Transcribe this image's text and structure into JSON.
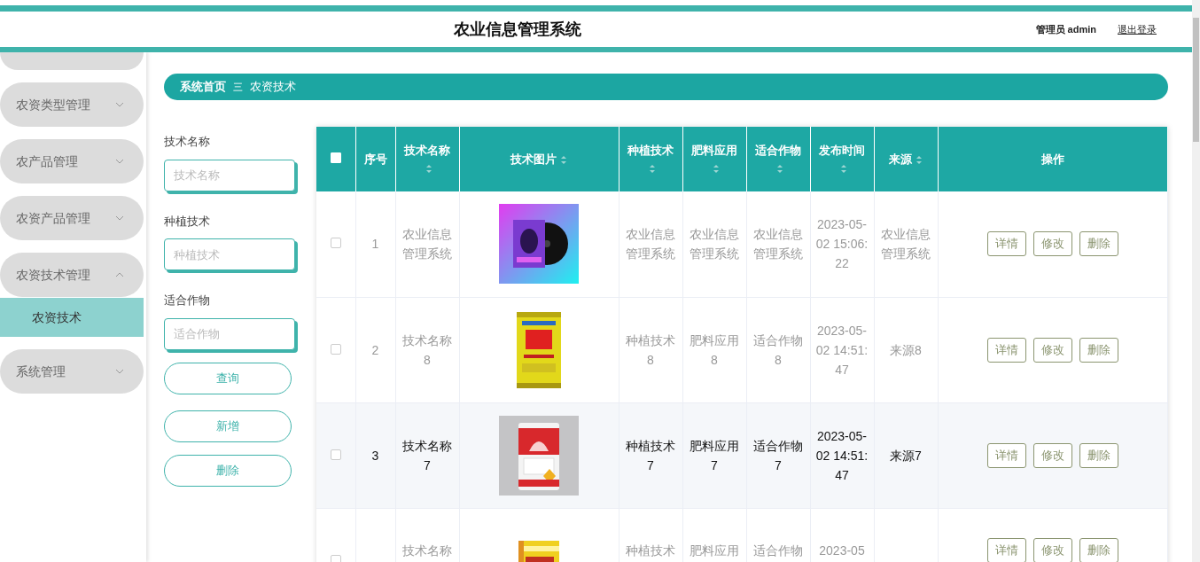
{
  "header": {
    "title": "农业信息管理系统",
    "user": "管理员 admin",
    "logout": "退出登录"
  },
  "sidebar": {
    "items": [
      {
        "label": "农资类型管理",
        "expanded": false
      },
      {
        "label": "农产品管理",
        "expanded": false
      },
      {
        "label": "农资产品管理",
        "expanded": false
      },
      {
        "label": "农资技术管理",
        "expanded": true,
        "children": [
          {
            "label": "农资技术",
            "selected": true
          }
        ]
      },
      {
        "label": "系统管理",
        "expanded": false
      }
    ]
  },
  "breadcrumb": {
    "home": "系统首页",
    "separator": "三",
    "current": "农资技术"
  },
  "search": {
    "fields": [
      {
        "label": "技术名称",
        "placeholder": "技术名称"
      },
      {
        "label": "种植技术",
        "placeholder": "种植技术"
      },
      {
        "label": "适合作物",
        "placeholder": "适合作物"
      }
    ],
    "buttons": [
      "查询",
      "新增",
      "删除"
    ]
  },
  "table": {
    "select_all": {
      "checked": false
    },
    "columns": [
      {
        "label": "序号",
        "sortable": false
      },
      {
        "label": "技术名称",
        "sortable": true
      },
      {
        "label": "技术图片",
        "sortable": true
      },
      {
        "label": "种植技术",
        "sortable": true
      },
      {
        "label": "肥料应用",
        "sortable": true
      },
      {
        "label": "适合作物",
        "sortable": true
      },
      {
        "label": "发布时间",
        "sortable": true
      },
      {
        "label": "来源",
        "sortable": true
      },
      {
        "label": "操作",
        "sortable": false
      }
    ],
    "rows": [
      {
        "checked": false,
        "highlighted": false,
        "cells": {
          "no": "1",
          "name": "农业信息管理系统",
          "image": {
            "kind": "picture"
          },
          "planting": "农业信息管理系统",
          "fertilizer": "农业信息管理系统",
          "crop": "农业信息管理系统",
          "time": "2023-05-02 15:06:22",
          "source": "农业信息管理系统",
          "actions": [
            "详情",
            "修改",
            "删除"
          ]
        }
      },
      {
        "checked": false,
        "highlighted": false,
        "cells": {
          "no": "2",
          "name": "技术名称8",
          "image": {
            "kind": "picture"
          },
          "planting": "种植技术8",
          "fertilizer": "肥料应用8",
          "crop": "适合作物8",
          "time": "2023-05-02 14:51:47",
          "source": "来源8",
          "actions": [
            "详情",
            "修改",
            "删除"
          ]
        }
      },
      {
        "checked": false,
        "highlighted": true,
        "cells": {
          "no": "3",
          "name": "技术名称7",
          "image": {
            "kind": "picture"
          },
          "planting": "种植技术7",
          "fertilizer": "肥料应用7",
          "crop": "适合作物7",
          "time": "2023-05-02 14:51:47",
          "source": "来源7",
          "actions": [
            "详情",
            "修改",
            "删除"
          ]
        }
      },
      {
        "checked": false,
        "highlighted": false,
        "cells": {
          "name": "技术名称",
          "image": {
            "kind": "picture"
          },
          "planting": "种植技术",
          "fertilizer": "肥料应用",
          "crop": "适合作物",
          "time": "2023-05",
          "actions": [
            "详情",
            "修改",
            "删除"
          ]
        }
      }
    ]
  }
}
